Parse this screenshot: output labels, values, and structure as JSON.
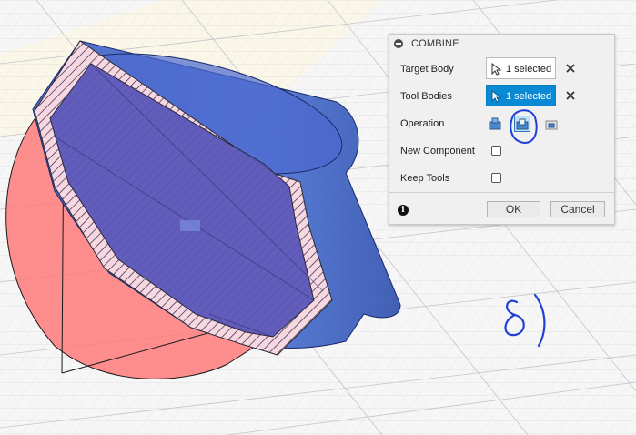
{
  "dialog": {
    "title": "COMBINE",
    "target_body_label": "Target Body",
    "target_body_value": "1 selected",
    "tool_bodies_label": "Tool Bodies",
    "tool_bodies_value": "1 selected",
    "operation_label": "Operation",
    "operation_options": [
      "join-icon",
      "cut-icon",
      "intersect-icon"
    ],
    "operation_selected": "cut-icon",
    "new_component_label": "New Component",
    "new_component_checked": false,
    "keep_tools_label": "Keep Tools",
    "keep_tools_checked": false,
    "ok_label": "OK",
    "cancel_label": "Cancel"
  },
  "annotation_text": "8)",
  "colors": {
    "selection_blue": "#0a8ad4",
    "body_blue": "#3f5fc8",
    "tool_body_red": "#ff7a7a",
    "annotation_ink": "#1f3fd6"
  }
}
